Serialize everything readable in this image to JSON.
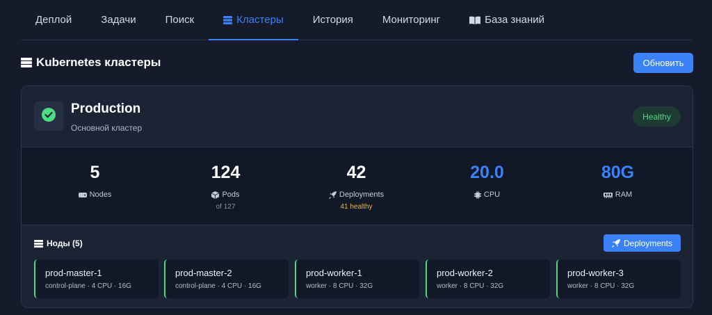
{
  "tabs": [
    {
      "label": "Деплой",
      "icon": ""
    },
    {
      "label": "Задачи",
      "icon": ""
    },
    {
      "label": "Поиск",
      "icon": ""
    },
    {
      "label": "Кластеры",
      "icon": "server-icon",
      "active": true
    },
    {
      "label": "История",
      "icon": ""
    },
    {
      "label": "Мониторинг",
      "icon": ""
    },
    {
      "label": "База знаний",
      "icon": "book-icon"
    }
  ],
  "section": {
    "title": "Kubernetes кластеры",
    "refresh_label": "Обновить"
  },
  "cluster": {
    "name": "Production",
    "description": "Основной кластер",
    "status": "Healthy",
    "metrics": [
      {
        "value": "5",
        "label": "Nodes",
        "sub": "",
        "icon": "server-icon"
      },
      {
        "value": "124",
        "label": "Pods",
        "sub": "of 127",
        "icon": "cube-icon"
      },
      {
        "value": "42",
        "label": "Deployments",
        "sub": "41 healthy",
        "icon": "rocket-icon"
      },
      {
        "value": "20.0",
        "label": "CPU",
        "sub": "",
        "icon": "chip-icon"
      },
      {
        "value": "80G",
        "label": "RAM",
        "sub": "",
        "icon": "memory-icon"
      }
    ],
    "nodes_title": "Ноды (5)",
    "deployments_button": "Deployments",
    "nodes": [
      {
        "name": "prod-master-1",
        "meta": "control-plane · 4 CPU · 16G"
      },
      {
        "name": "prod-master-2",
        "meta": "control-plane · 4 CPU · 16G"
      },
      {
        "name": "prod-worker-1",
        "meta": "worker · 8 CPU · 32G"
      },
      {
        "name": "prod-worker-2",
        "meta": "worker · 8 CPU · 32G"
      },
      {
        "name": "prod-worker-3",
        "meta": "worker · 8 CPU · 32G"
      }
    ]
  },
  "colors": {
    "accent": "#3b82f6",
    "healthy": "#4ade80",
    "warning": "#f5b73b"
  }
}
